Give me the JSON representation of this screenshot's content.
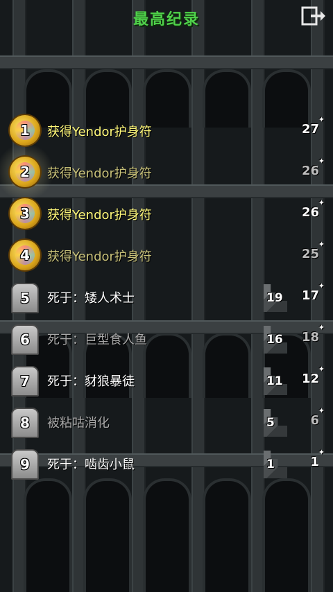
{
  "header": {
    "title": "最高纪录",
    "exit_icon": "exit-icon"
  },
  "records": [
    {
      "rank": "1",
      "description": "获得Yendor护身符",
      "depth": "",
      "level": "27",
      "type": "win",
      "highlight": false
    },
    {
      "rank": "2",
      "description": "获得Yendor护身符",
      "depth": "",
      "level": "26",
      "type": "win",
      "highlight": true
    },
    {
      "rank": "3",
      "description": "获得Yendor护身符",
      "depth": "",
      "level": "26",
      "type": "win",
      "highlight": false
    },
    {
      "rank": "4",
      "description": "获得Yendor护身符",
      "depth": "",
      "level": "25",
      "type": "win",
      "highlight": false
    },
    {
      "rank": "5",
      "description": "死于：矮人术士",
      "depth": "19",
      "level": "17",
      "type": "death",
      "highlight": false
    },
    {
      "rank": "6",
      "description": "死于：巨型食人鱼",
      "depth": "16",
      "level": "18",
      "type": "death",
      "highlight": false
    },
    {
      "rank": "7",
      "description": "死于：豺狼暴徒",
      "depth": "11",
      "level": "12",
      "type": "death",
      "highlight": false
    },
    {
      "rank": "8",
      "description": "被粘咕消化",
      "depth": "5",
      "level": "6",
      "type": "death",
      "highlight": false
    },
    {
      "rank": "9",
      "description": "死于：啮齿小鼠",
      "depth": "1",
      "level": "1",
      "type": "death",
      "highlight": false
    }
  ],
  "colors": {
    "title": "#4fd14a",
    "win_text": "#fff87a",
    "death_text": "#ffffff",
    "background": "#161a1c"
  }
}
